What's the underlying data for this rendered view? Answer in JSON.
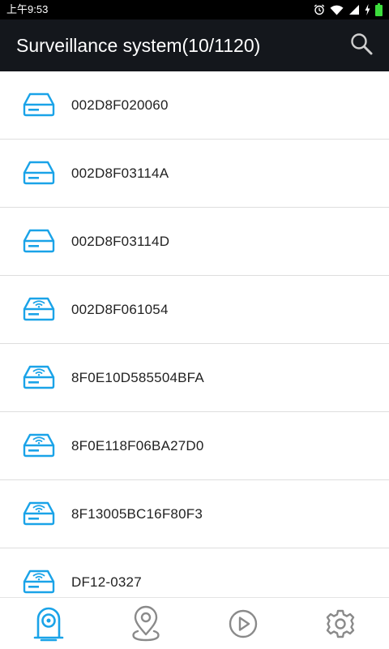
{
  "status_bar": {
    "time": "上午9:53",
    "icons": [
      "alarm-icon",
      "wifi-icon",
      "signal-icon",
      "charging-icon",
      "battery-icon"
    ]
  },
  "header": {
    "title": "Surveillance system(10/1120)",
    "search_icon": "search-icon"
  },
  "devices": [
    {
      "name": "002D8F020060",
      "icon": "dvr-icon"
    },
    {
      "name": "002D8F03114A",
      "icon": "dvr-icon"
    },
    {
      "name": "002D8F03114D",
      "icon": "dvr-icon"
    },
    {
      "name": "002D8F061054",
      "icon": "dvr-wifi-icon"
    },
    {
      "name": "8F0E10D585504BFA",
      "icon": "dvr-wifi-icon"
    },
    {
      "name": "8F0E118F06BA27D0",
      "icon": "dvr-wifi-icon"
    },
    {
      "name": "8F13005BC16F80F3",
      "icon": "dvr-wifi-icon"
    },
    {
      "name": "DF12-0327",
      "icon": "dvr-wifi-icon"
    }
  ],
  "bottom_nav": {
    "items": [
      {
        "icon": "camera-icon",
        "active": true
      },
      {
        "icon": "location-pin-icon",
        "active": false
      },
      {
        "icon": "playback-icon",
        "active": false
      },
      {
        "icon": "gear-icon",
        "active": false
      }
    ]
  },
  "colors": {
    "accent": "#1aa3e8",
    "inactive": "#8a8a8a",
    "header_bg": "#14171c",
    "status_bg": "#000000",
    "battery": "#3cdc3c"
  }
}
